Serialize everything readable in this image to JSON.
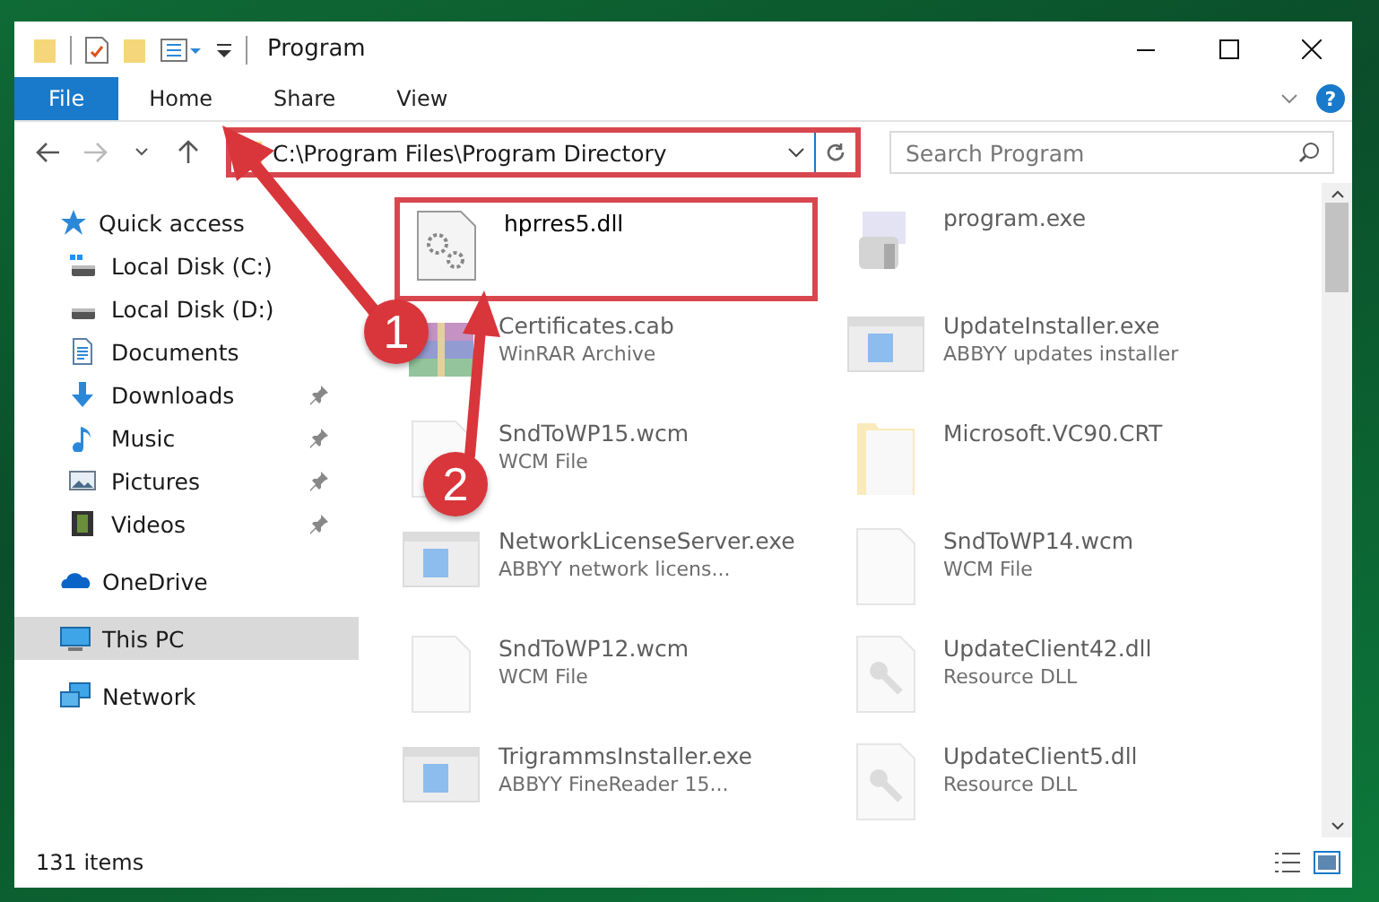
{
  "window": {
    "title": "Program"
  },
  "ribbon": {
    "tabs": [
      {
        "label": "File",
        "kind": "file",
        "selected": false
      },
      {
        "label": "Home",
        "kind": "tab",
        "selected": false
      },
      {
        "label": "Share",
        "kind": "tab",
        "selected": false
      },
      {
        "label": "View",
        "kind": "tab",
        "selected": false
      }
    ],
    "help": "?"
  },
  "address_bar": {
    "path": "C:\\Program Files\\Program Directory",
    "highlighted": true
  },
  "search": {
    "placeholder": "Search Program"
  },
  "sidebar": {
    "items": [
      {
        "label": "Quick access",
        "kind": "star",
        "selected": false,
        "children": [
          {
            "label": "Local Disk (C:)",
            "kind": "disk-windows",
            "pinned": false
          },
          {
            "label": "Local Disk (D:)",
            "kind": "disk",
            "pinned": false
          },
          {
            "label": "Documents",
            "kind": "document",
            "pinned": false
          },
          {
            "label": "Downloads",
            "kind": "download",
            "pinned": true
          },
          {
            "label": "Music",
            "kind": "music",
            "pinned": true
          },
          {
            "label": "Pictures",
            "kind": "pictures",
            "pinned": true
          },
          {
            "label": "Videos",
            "kind": "film",
            "pinned": true
          }
        ]
      },
      {
        "label": "OneDrive",
        "kind": "cloud",
        "selected": false
      },
      {
        "label": "This PC",
        "kind": "monitor",
        "selected": true
      },
      {
        "label": "Network",
        "kind": "network",
        "selected": false
      }
    ]
  },
  "files": [
    {
      "name": "hprres5.dll",
      "kind": "dll",
      "highlighted": true
    },
    {
      "name": "program.exe",
      "kind": "program",
      "highlighted": false
    },
    {
      "name": "Certificates.cab",
      "type": "WinRAR Archive",
      "kind": "archive",
      "highlighted": false
    },
    {
      "name": "UpdateInstaller.exe",
      "type": "ABBYY updates installer",
      "kind": "exe",
      "highlighted": false
    },
    {
      "name": "SndToWP15.wcm",
      "type": "WCM File",
      "kind": "file",
      "highlighted": false
    },
    {
      "name": "Microsoft.VC90.CRT",
      "kind": "folder",
      "highlighted": false
    },
    {
      "name": "NetworkLicenseServer.exe",
      "type": "ABBYY network licens...",
      "kind": "exe",
      "highlighted": false
    },
    {
      "name": "SndToWP14.wcm",
      "type": "WCM File",
      "kind": "file",
      "highlighted": false
    },
    {
      "name": "SndToWP12.wcm",
      "type": "WCM File",
      "kind": "file",
      "highlighted": false
    },
    {
      "name": "UpdateClient42.dll",
      "type": "Resource DLL",
      "kind": "resource",
      "highlighted": false
    },
    {
      "name": "TrigrammsInstaller.exe",
      "type": "ABBYY FineReader 15...",
      "kind": "exe",
      "highlighted": false
    },
    {
      "name": "UpdateClient5.dll",
      "type": "Resource DLL",
      "kind": "resource",
      "highlighted": false
    }
  ],
  "status_bar": {
    "count": "131 items"
  },
  "annotations": [
    {
      "label": "1"
    },
    {
      "label": "2"
    }
  ]
}
